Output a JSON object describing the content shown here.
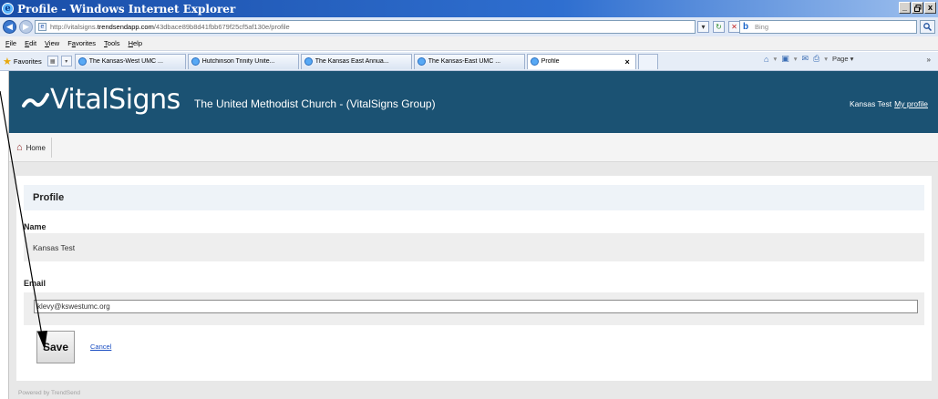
{
  "window": {
    "title": "Profile - Windows Internet Explorer",
    "controls": [
      "_",
      "Ʒ",
      "x"
    ]
  },
  "address": {
    "url_prefix": "http://vitalsigns.",
    "url_domain": "trendsendapp.com",
    "url_suffix": "/43dbace89b8d41fbb679f25cf5af130e/profile",
    "search_placeholder": "Bing"
  },
  "menu": {
    "items": [
      {
        "u": "F",
        "rest": "ile"
      },
      {
        "u": "E",
        "rest": "dit"
      },
      {
        "u": "V",
        "rest": "iew"
      },
      {
        "pre": "F",
        "u": "a",
        "rest": "vorites"
      },
      {
        "u": "T",
        "rest": "ools"
      },
      {
        "u": "H",
        "rest": "elp"
      }
    ]
  },
  "favorites": {
    "label": "Favorites",
    "tabs": [
      {
        "label": "The Kansas-West UMC ..."
      },
      {
        "label": "Hutchinson Trinity Unite..."
      },
      {
        "label": "The Kansas East Annua..."
      },
      {
        "label": "The Kansas-East UMC ..."
      },
      {
        "label": "Profile"
      }
    ],
    "page_label": "Page"
  },
  "app": {
    "brand": "VitalSigns",
    "org": "The United Methodist Church - (VitalSigns Group)",
    "user_name": "Kansas Test",
    "profile_link": "My profile",
    "nav_home": "Home",
    "accent": "#1b5273"
  },
  "profile": {
    "title": "Profile",
    "name_label": "Name",
    "name_value": "Kansas Test",
    "email_label": "Email",
    "email_value": "klevy@kswestumc.org",
    "save_label": "Save",
    "cancel_label": "Cancel"
  },
  "footer": {
    "text": "Powered by TrendSend"
  }
}
